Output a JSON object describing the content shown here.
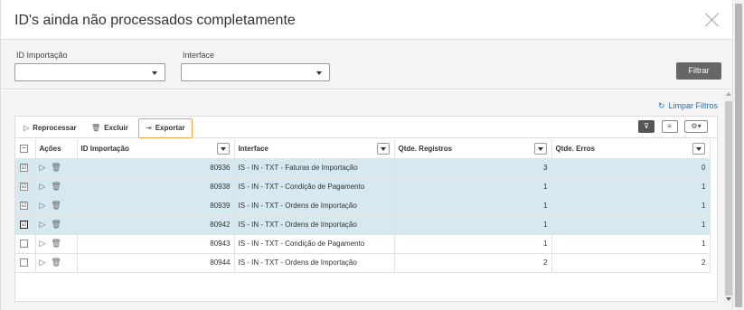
{
  "modal": {
    "title": "ID's ainda não processados completamente"
  },
  "filters": {
    "id_label": "ID Importação",
    "id_value": "",
    "interface_label": "Interface",
    "interface_value": "",
    "filter_button": "Filtrar"
  },
  "grid": {
    "limpar_filtros": "Limpar Filtros",
    "toolbar": {
      "reprocessar": "Reprocessar",
      "excluir": "Excluir",
      "exportar": "Exportar"
    },
    "columns": {
      "acoes": "Ações",
      "id": "ID Importação",
      "interface": "Interface",
      "registros": "Qtde. Registros",
      "erros": "Qtde. Erros"
    },
    "rows": [
      {
        "id": "80936",
        "interface": "IS - IN - TXT - Faturas de Importação",
        "registros": "3",
        "erros": "0",
        "checked": true
      },
      {
        "id": "80938",
        "interface": "IS - IN - TXT - Condição de Pagamento",
        "registros": "1",
        "erros": "1",
        "checked": true
      },
      {
        "id": "80939",
        "interface": "IS - IN - TXT - Ordens de Importação",
        "registros": "1",
        "erros": "1",
        "checked": true
      },
      {
        "id": "80942",
        "interface": "IS - IN - TXT - Ordens de Importação",
        "registros": "1",
        "erros": "1",
        "checked": true
      },
      {
        "id": "80943",
        "interface": "IS - IN - TXT - Condição de Pagamento",
        "registros": "1",
        "erros": "1",
        "checked": false
      },
      {
        "id": "80944",
        "interface": "IS - IN - TXT - Ordens de Importação",
        "registros": "2",
        "erros": "2",
        "checked": false
      }
    ]
  },
  "colors": {
    "selected_row": "#d6e9f0",
    "export_border": "#f0a045",
    "link": "#1f6fb5"
  }
}
